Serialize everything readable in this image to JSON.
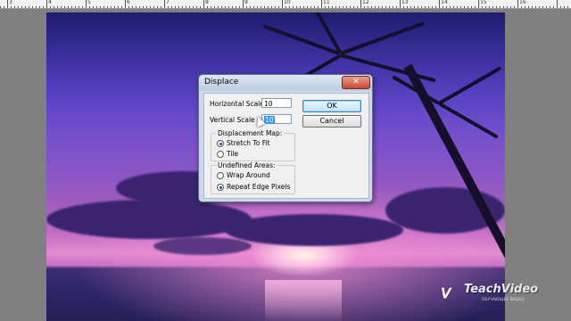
{
  "ruler": {
    "labels": [
      "3",
      "4",
      "5",
      "6",
      "7",
      "8",
      "9",
      "10",
      "11",
      "12",
      "13",
      "14",
      "15",
      "16"
    ]
  },
  "dialog": {
    "title": "Displace",
    "close_icon": "close-x-icon",
    "horizontal_scale_label": "Horizontal Scale",
    "horizontal_scale_value": "10",
    "vertical_scale_label": "Vertical Scale",
    "vertical_scale_value": "10",
    "ok_label": "OK",
    "cancel_label": "Cancel",
    "displacement_map": {
      "title": "Displacement Map:",
      "options": [
        {
          "label": "Stretch To Fit",
          "selected": true
        },
        {
          "label": "Tile",
          "selected": false
        }
      ]
    },
    "undefined_areas": {
      "title": "Undefined Areas:",
      "options": [
        {
          "label": "Wrap Around",
          "selected": false
        },
        {
          "label": "Repeat Edge Pixels",
          "selected": true
        }
      ]
    }
  },
  "watermark": {
    "logo": "TV",
    "name": "TeachVideo",
    "tagline": "ОБУЧАЮЩЕЕ ВИДЕО"
  },
  "colors": {
    "dialog_frame": "#cdd9e8",
    "close_button": "#c8472f",
    "sky_top": "#1d1c6e",
    "horizon_glow": "#e38cd0"
  }
}
